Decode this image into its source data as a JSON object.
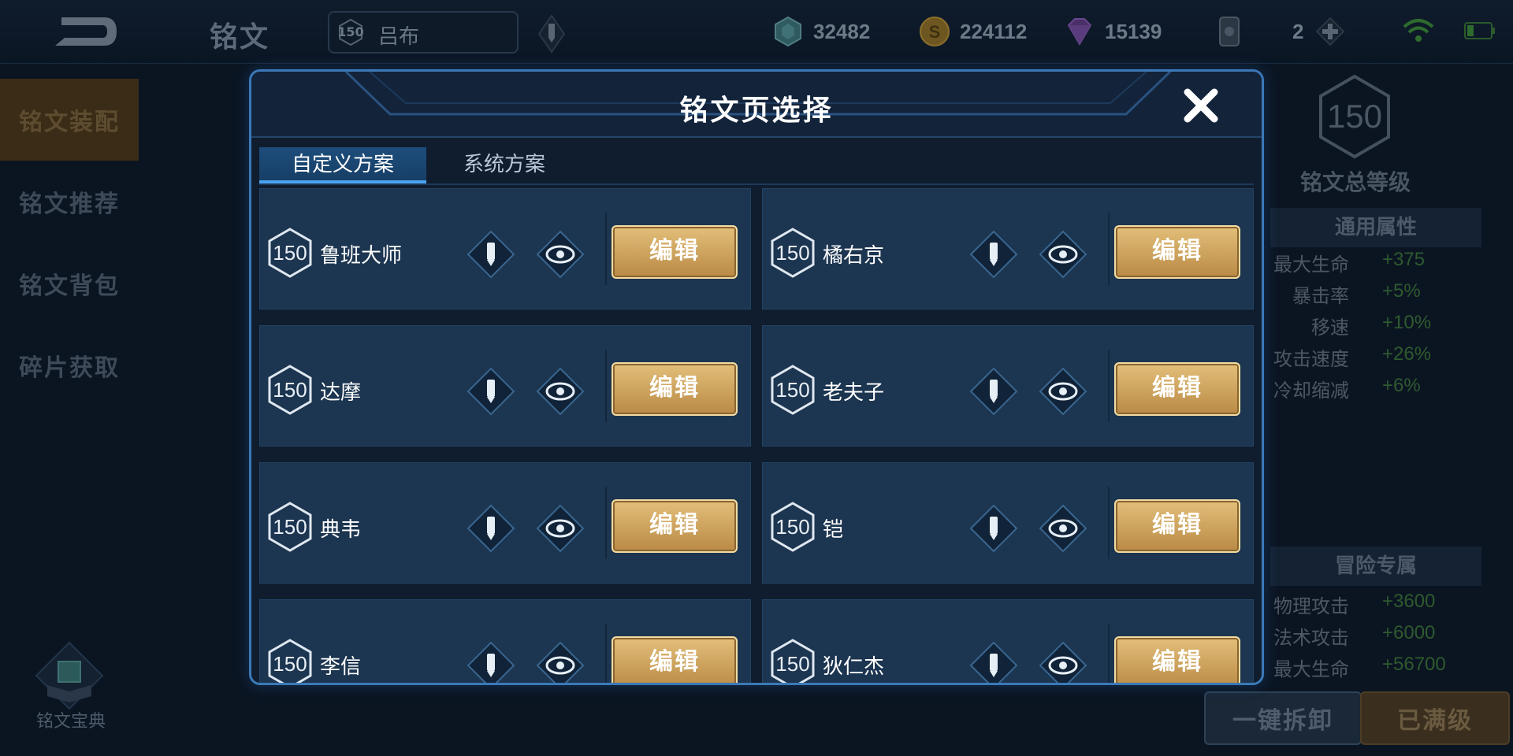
{
  "topbar": {
    "title": "铭文",
    "hero": {
      "level": "150",
      "name": "吕布"
    },
    "currencies": [
      {
        "icon": "crystal-icon",
        "value": "32482"
      },
      {
        "icon": "gold-coin-icon",
        "value": "224112"
      },
      {
        "icon": "gem-icon",
        "value": "15139"
      },
      {
        "icon": "card-icon",
        "value": "2"
      }
    ]
  },
  "sidebar": {
    "items": [
      {
        "label": "铭文装配",
        "active": true
      },
      {
        "label": "铭文推荐",
        "active": false
      },
      {
        "label": "铭文背包",
        "active": false
      },
      {
        "label": "碎片获取",
        "active": false
      }
    ],
    "codex_label": "铭文宝典"
  },
  "right_panel": {
    "total_level": "150",
    "total_level_label": "铭文总等级",
    "general_title": "通用属性",
    "general_stats": [
      {
        "name": "最大生命",
        "value": "+375"
      },
      {
        "name": "暴击率",
        "value": "+5%"
      },
      {
        "name": "移速",
        "value": "+10%"
      },
      {
        "name": "攻击速度",
        "value": "+26%"
      },
      {
        "name": "冷却缩减",
        "value": "+6%"
      }
    ],
    "adventure_title": "冒险专属",
    "adventure_stats": [
      {
        "name": "物理攻击",
        "value": "+3600"
      },
      {
        "name": "法术攻击",
        "value": "+6000"
      },
      {
        "name": "最大生命",
        "value": "+56700"
      }
    ],
    "unload_all": "一键拆卸",
    "maxed": "已满级"
  },
  "modal": {
    "title": "铭文页选择",
    "tabs": {
      "custom": "自定义方案",
      "system": "系统方案"
    },
    "edit_label": "编辑",
    "pages": [
      {
        "level": "150",
        "name": "鲁班大师"
      },
      {
        "level": "150",
        "name": "橘右京"
      },
      {
        "level": "150",
        "name": "达摩"
      },
      {
        "level": "150",
        "name": "老夫子"
      },
      {
        "level": "150",
        "name": "典韦"
      },
      {
        "level": "150",
        "name": "铠"
      },
      {
        "level": "150",
        "name": "李信"
      },
      {
        "level": "150",
        "name": "狄仁杰"
      }
    ]
  },
  "colors": {
    "modal_border": "#3b79b8",
    "card_bg": "#1c3550",
    "edit_button_gold": "#d3ab62",
    "stat_value_green": "#2e5a2e"
  }
}
